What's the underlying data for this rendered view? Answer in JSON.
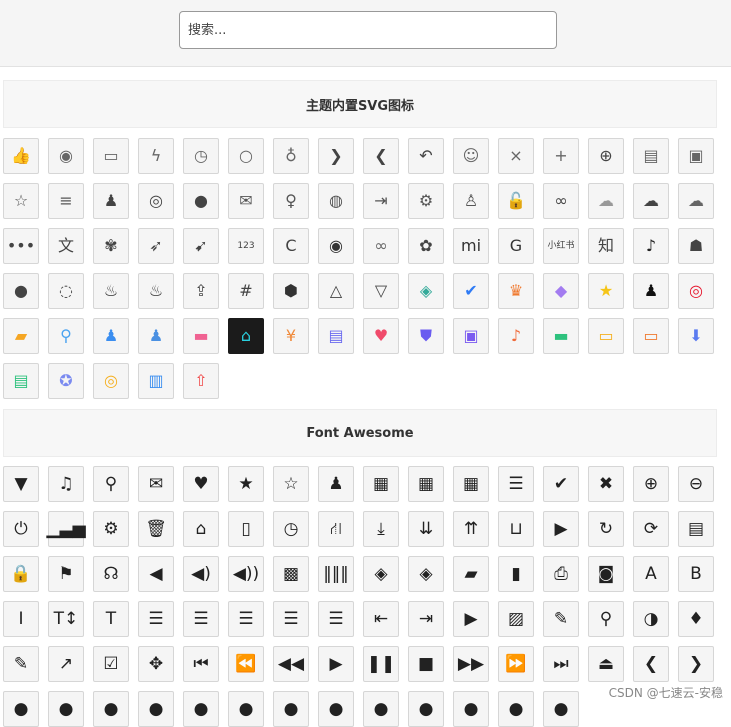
{
  "search": {
    "placeholder": "搜索..."
  },
  "sections": {
    "svg": {
      "title": "主题内置SVG图标"
    },
    "fa": {
      "title": "Font Awesome"
    }
  },
  "watermark": "CSDN @七速云-安稳",
  "svg_icons": [
    {
      "name": "thumbs-up-icon",
      "glyph": "👍",
      "color": "#666"
    },
    {
      "name": "eye-icon",
      "glyph": "◉",
      "color": "#666"
    },
    {
      "name": "comment-icon",
      "glyph": "▭",
      "color": "#666"
    },
    {
      "name": "lightning-circle-icon",
      "glyph": "ϟ",
      "color": "#666"
    },
    {
      "name": "clock-icon",
      "glyph": "◷",
      "color": "#666"
    },
    {
      "name": "search-icon",
      "glyph": "○",
      "color": "#666"
    },
    {
      "name": "money-bag-icon",
      "glyph": "♁",
      "color": "#666"
    },
    {
      "name": "chevron-right-icon",
      "glyph": "❯",
      "color": "#444"
    },
    {
      "name": "chevron-left-icon",
      "glyph": "❮",
      "color": "#444"
    },
    {
      "name": "reply-icon",
      "glyph": "↶",
      "color": "#444"
    },
    {
      "name": "github-icon",
      "glyph": "☺",
      "color": "#666"
    },
    {
      "name": "close-icon",
      "glyph": "×",
      "color": "#666"
    },
    {
      "name": "plus-icon",
      "glyph": "+",
      "color": "#666"
    },
    {
      "name": "plus-circle-icon",
      "glyph": "⊕",
      "color": "#444"
    },
    {
      "name": "document-icon",
      "glyph": "▤",
      "color": "#666"
    },
    {
      "name": "chat-icon",
      "glyph": "▣",
      "color": "#666"
    },
    {
      "name": "star-outline-icon",
      "glyph": "☆",
      "color": "#555"
    },
    {
      "name": "menu-icon",
      "glyph": "≡",
      "color": "#555"
    },
    {
      "name": "qq-icon",
      "glyph": "♟",
      "color": "#444"
    },
    {
      "name": "weibo-icon",
      "glyph": "◎",
      "color": "#444"
    },
    {
      "name": "wechat-icon",
      "glyph": "●",
      "color": "#444"
    },
    {
      "name": "mail-icon",
      "glyph": "✉",
      "color": "#555"
    },
    {
      "name": "badge-icon",
      "glyph": "♀",
      "color": "#555"
    },
    {
      "name": "palette-icon",
      "glyph": "◍",
      "color": "#555"
    },
    {
      "name": "login-icon",
      "glyph": "⇥",
      "color": "#555"
    },
    {
      "name": "settings-icon",
      "glyph": "⚙",
      "color": "#555"
    },
    {
      "name": "add-user-icon",
      "glyph": "♙",
      "color": "#555"
    },
    {
      "name": "unlock-icon",
      "glyph": "🔓",
      "color": "#555"
    },
    {
      "name": "circles-icon",
      "glyph": "∞",
      "color": "#444"
    },
    {
      "name": "cloud-icon",
      "glyph": "☁",
      "color": "#999"
    },
    {
      "name": "cloud-filled-icon",
      "glyph": "☁",
      "color": "#444"
    },
    {
      "name": "cloud-link-icon",
      "glyph": "☁",
      "color": "#666"
    },
    {
      "name": "more-icon",
      "glyph": "•••",
      "color": "#444"
    },
    {
      "name": "translate-icon",
      "glyph": "文",
      "color": "#444"
    },
    {
      "name": "baidu-icon",
      "glyph": "✾",
      "color": "#444"
    },
    {
      "name": "bird-icon",
      "glyph": "➶",
      "color": "#444"
    },
    {
      "name": "dove-icon",
      "glyph": "➹",
      "color": "#444"
    },
    {
      "name": "counter-icon",
      "glyph": "123",
      "color": "#444",
      "small": true
    },
    {
      "name": "c-logo-icon",
      "glyph": "C",
      "color": "#444"
    },
    {
      "name": "ring-icon",
      "glyph": "◉",
      "color": "#333"
    },
    {
      "name": "link-icon",
      "glyph": "∞",
      "color": "#666"
    },
    {
      "name": "huawei-icon",
      "glyph": "✿",
      "color": "#444"
    },
    {
      "name": "xiaomi-icon",
      "glyph": "mi",
      "color": "#333"
    },
    {
      "name": "g-logo-icon",
      "glyph": "G",
      "color": "#333"
    },
    {
      "name": "brand-text-icon",
      "glyph": "小红书",
      "color": "#444",
      "small": true
    },
    {
      "name": "zhihu-icon",
      "glyph": "知",
      "color": "#444"
    },
    {
      "name": "tiktok-icon",
      "glyph": "♪",
      "color": "#222"
    },
    {
      "name": "bilibili-icon",
      "glyph": "☗",
      "color": "#444"
    },
    {
      "name": "speech-bubble-icon",
      "glyph": "●",
      "color": "#444"
    },
    {
      "name": "chat-dots-icon",
      "glyph": "◌",
      "color": "#444"
    },
    {
      "name": "flame-icon",
      "glyph": "♨",
      "color": "#333"
    },
    {
      "name": "fire-icon",
      "glyph": "♨",
      "color": "#333"
    },
    {
      "name": "upload-icon",
      "glyph": "⇪",
      "color": "#444"
    },
    {
      "name": "hash-icon",
      "glyph": "#",
      "color": "#444"
    },
    {
      "name": "cube-icon",
      "glyph": "⬢",
      "color": "#333"
    },
    {
      "name": "triangle-up-icon",
      "glyph": "△",
      "color": "#444"
    },
    {
      "name": "triangle-down-icon",
      "glyph": "▽",
      "color": "#444"
    },
    {
      "name": "tag-icon",
      "glyph": "◈",
      "color": "#3a9"
    },
    {
      "name": "verified-icon",
      "glyph": "✔",
      "color": "#2f7bf5"
    },
    {
      "name": "crown-icon",
      "glyph": "♛",
      "color": "#f07a30"
    },
    {
      "name": "diamond-icon",
      "glyph": "◆",
      "color": "#a37cf0"
    },
    {
      "name": "star-badge-icon",
      "glyph": "★",
      "color": "#f5c518"
    },
    {
      "name": "qq-color-icon",
      "glyph": "♟",
      "color": "#111"
    },
    {
      "name": "weibo-color-icon",
      "glyph": "◎",
      "color": "#e6162d"
    },
    {
      "name": "image-color-icon",
      "glyph": "▰",
      "color": "#f5a623"
    },
    {
      "name": "link-color-icon",
      "glyph": "⚲",
      "color": "#4aa3f0"
    },
    {
      "name": "user-card-icon",
      "glyph": "♟",
      "color": "#3b8ef0"
    },
    {
      "name": "user-color-icon",
      "glyph": "♟",
      "color": "#4a90e2"
    },
    {
      "name": "battery-icon",
      "glyph": "▬",
      "color": "#f06292"
    },
    {
      "name": "home-icon",
      "glyph": "⌂",
      "color": "#2ad1e0",
      "dark": true
    },
    {
      "name": "money-color-icon",
      "glyph": "¥",
      "color": "#f08a3a"
    },
    {
      "name": "clipboard-icon",
      "glyph": "▤",
      "color": "#6c6cf0"
    },
    {
      "name": "gift-icon",
      "glyph": "♥",
      "color": "#f04b6b"
    },
    {
      "name": "shield-icon",
      "glyph": "⛊",
      "color": "#6a5cf0"
    },
    {
      "name": "monitor-chart-icon",
      "glyph": "▣",
      "color": "#7a5af0"
    },
    {
      "name": "bell-icon",
      "glyph": "♪",
      "color": "#f06a3a"
    },
    {
      "name": "wallet-icon",
      "glyph": "▬",
      "color": "#2ec27e"
    },
    {
      "name": "message-color-icon",
      "glyph": "▭",
      "color": "#f5b020"
    },
    {
      "name": "card-color-icon",
      "glyph": "▭",
      "color": "#f07a30"
    },
    {
      "name": "download-box-icon",
      "glyph": "⬇",
      "color": "#5b7bf0"
    },
    {
      "name": "store-icon",
      "glyph": "▤",
      "color": "#2ec27e"
    },
    {
      "name": "medal-icon",
      "glyph": "✪",
      "color": "#7a8af0"
    },
    {
      "name": "coins-icon",
      "glyph": "◎",
      "color": "#f5b020"
    },
    {
      "name": "book-icon",
      "glyph": "▥",
      "color": "#3b8ef0"
    },
    {
      "name": "rocket-icon",
      "glyph": "⇧",
      "color": "#f04b4b"
    }
  ],
  "fa_icons": [
    {
      "name": "filter-icon",
      "glyph": "▼",
      "color": "#222"
    },
    {
      "name": "music-icon",
      "glyph": "♫",
      "color": "#222"
    },
    {
      "name": "search-icon",
      "glyph": "⚲",
      "color": "#222"
    },
    {
      "name": "envelope-icon",
      "glyph": "✉",
      "color": "#222"
    },
    {
      "name": "heart-icon",
      "glyph": "♥",
      "color": "#222"
    },
    {
      "name": "star-icon",
      "glyph": "★",
      "color": "#222"
    },
    {
      "name": "star-empty-icon",
      "glyph": "☆",
      "color": "#222"
    },
    {
      "name": "user-icon",
      "glyph": "♟",
      "color": "#222"
    },
    {
      "name": "film-icon",
      "glyph": "▦",
      "color": "#222"
    },
    {
      "name": "th-large-icon",
      "glyph": "▦",
      "color": "#222"
    },
    {
      "name": "th-icon",
      "glyph": "▦",
      "color": "#222"
    },
    {
      "name": "th-list-icon",
      "glyph": "☰",
      "color": "#222"
    },
    {
      "name": "check-icon",
      "glyph": "✔",
      "color": "#222"
    },
    {
      "name": "times-icon",
      "glyph": "✖",
      "color": "#222"
    },
    {
      "name": "zoom-in-icon",
      "glyph": "⊕",
      "color": "#222"
    },
    {
      "name": "zoom-out-icon",
      "glyph": "⊖",
      "color": "#222"
    },
    {
      "name": "power-off-icon",
      "glyph": "⏻",
      "color": "#222"
    },
    {
      "name": "signal-icon",
      "glyph": "▁▃▅",
      "color": "#222",
      "small": true
    },
    {
      "name": "cog-icon",
      "glyph": "⚙",
      "color": "#222"
    },
    {
      "name": "trash-icon",
      "glyph": "🗑",
      "color": "#222"
    },
    {
      "name": "home-icon",
      "glyph": "⌂",
      "color": "#222"
    },
    {
      "name": "file-icon",
      "glyph": "▯",
      "color": "#222"
    },
    {
      "name": "clock-icon",
      "glyph": "◷",
      "color": "#222"
    },
    {
      "name": "road-icon",
      "glyph": "⛙",
      "color": "#222"
    },
    {
      "name": "download-icon",
      "glyph": "⤓",
      "color": "#222"
    },
    {
      "name": "arrow-circle-down-icon",
      "glyph": "⇊",
      "color": "#222"
    },
    {
      "name": "arrow-circle-up-icon",
      "glyph": "⇈",
      "color": "#222"
    },
    {
      "name": "inbox-icon",
      "glyph": "⊔",
      "color": "#222"
    },
    {
      "name": "play-circle-icon",
      "glyph": "▶",
      "color": "#222"
    },
    {
      "name": "repeat-icon",
      "glyph": "↻",
      "color": "#222"
    },
    {
      "name": "refresh-icon",
      "glyph": "⟳",
      "color": "#222"
    },
    {
      "name": "list-alt-icon",
      "glyph": "▤",
      "color": "#222"
    },
    {
      "name": "lock-icon",
      "glyph": "🔒",
      "color": "#222"
    },
    {
      "name": "flag-icon",
      "glyph": "⚑",
      "color": "#222"
    },
    {
      "name": "headphones-icon",
      "glyph": "☊",
      "color": "#222"
    },
    {
      "name": "volume-off-icon",
      "glyph": "◀",
      "color": "#222"
    },
    {
      "name": "volume-down-icon",
      "glyph": "◀)",
      "color": "#222",
      "small": true
    },
    {
      "name": "volume-up-icon",
      "glyph": "◀))",
      "color": "#222",
      "small": true
    },
    {
      "name": "qrcode-icon",
      "glyph": "▩",
      "color": "#222"
    },
    {
      "name": "barcode-icon",
      "glyph": "‖‖‖",
      "color": "#222",
      "small": true
    },
    {
      "name": "tag-icon",
      "glyph": "◈",
      "color": "#222"
    },
    {
      "name": "tags-icon",
      "glyph": "◈",
      "color": "#222"
    },
    {
      "name": "book-icon",
      "glyph": "▰",
      "color": "#222"
    },
    {
      "name": "bookmark-icon",
      "glyph": "▮",
      "color": "#222"
    },
    {
      "name": "print-icon",
      "glyph": "⎙",
      "color": "#222"
    },
    {
      "name": "camera-icon",
      "glyph": "◙",
      "color": "#222"
    },
    {
      "name": "font-icon",
      "glyph": "A",
      "color": "#222"
    },
    {
      "name": "bold-icon",
      "glyph": "B",
      "color": "#222"
    },
    {
      "name": "italic-icon",
      "glyph": "I",
      "color": "#222"
    },
    {
      "name": "text-height-icon",
      "glyph": "T↕",
      "color": "#222"
    },
    {
      "name": "text-width-icon",
      "glyph": "T",
      "color": "#222"
    },
    {
      "name": "align-left-icon",
      "glyph": "☰",
      "color": "#222"
    },
    {
      "name": "align-center-icon",
      "glyph": "☰",
      "color": "#222"
    },
    {
      "name": "align-right-icon",
      "glyph": "☰",
      "color": "#222"
    },
    {
      "name": "align-justify-icon",
      "glyph": "☰",
      "color": "#222"
    },
    {
      "name": "list-icon",
      "glyph": "☰",
      "color": "#222"
    },
    {
      "name": "outdent-icon",
      "glyph": "⇤",
      "color": "#222"
    },
    {
      "name": "indent-icon",
      "glyph": "⇥",
      "color": "#222"
    },
    {
      "name": "video-camera-icon",
      "glyph": "▶",
      "color": "#222"
    },
    {
      "name": "picture-icon",
      "glyph": "▨",
      "color": "#222"
    },
    {
      "name": "pencil-icon",
      "glyph": "✎",
      "color": "#222"
    },
    {
      "name": "map-marker-icon",
      "glyph": "⚲",
      "color": "#222"
    },
    {
      "name": "adjust-icon",
      "glyph": "◑",
      "color": "#222"
    },
    {
      "name": "tint-icon",
      "glyph": "♦",
      "color": "#222"
    },
    {
      "name": "edit-icon",
      "glyph": "✎",
      "color": "#222"
    },
    {
      "name": "share-icon",
      "glyph": "↗",
      "color": "#222"
    },
    {
      "name": "check-square-icon",
      "glyph": "☑",
      "color": "#222"
    },
    {
      "name": "move-icon",
      "glyph": "✥",
      "color": "#222"
    },
    {
      "name": "step-backward-icon",
      "glyph": "⏮",
      "color": "#222"
    },
    {
      "name": "fast-backward-icon",
      "glyph": "⏪",
      "color": "#222"
    },
    {
      "name": "backward-icon",
      "glyph": "◀◀",
      "color": "#222",
      "small": true
    },
    {
      "name": "play-icon",
      "glyph": "▶",
      "color": "#222"
    },
    {
      "name": "pause-icon",
      "glyph": "❚❚",
      "color": "#222",
      "small": true
    },
    {
      "name": "stop-icon",
      "glyph": "■",
      "color": "#222"
    },
    {
      "name": "forward-icon",
      "glyph": "▶▶",
      "color": "#222",
      "small": true
    },
    {
      "name": "fast-forward-icon",
      "glyph": "⏩",
      "color": "#222"
    },
    {
      "name": "step-forward-icon",
      "glyph": "⏭",
      "color": "#222"
    },
    {
      "name": "eject-icon",
      "glyph": "⏏",
      "color": "#222"
    },
    {
      "name": "chevron-left-icon",
      "glyph": "❮",
      "color": "#222"
    },
    {
      "name": "chevron-right-icon",
      "glyph": "❯",
      "color": "#222"
    },
    {
      "name": "partial-icon-1",
      "glyph": "●",
      "color": "#222"
    },
    {
      "name": "partial-icon-2",
      "glyph": "●",
      "color": "#222"
    },
    {
      "name": "partial-icon-3",
      "glyph": "●",
      "color": "#222"
    },
    {
      "name": "partial-icon-4",
      "glyph": "●",
      "color": "#222"
    },
    {
      "name": "partial-icon-5",
      "glyph": "●",
      "color": "#222"
    },
    {
      "name": "partial-icon-6",
      "glyph": "●",
      "color": "#222"
    },
    {
      "name": "partial-icon-7",
      "glyph": "●",
      "color": "#222"
    },
    {
      "name": "partial-icon-8",
      "glyph": "●",
      "color": "#222"
    },
    {
      "name": "partial-icon-9",
      "glyph": "●",
      "color": "#222"
    },
    {
      "name": "partial-icon-10",
      "glyph": "●",
      "color": "#222"
    },
    {
      "name": "partial-icon-11",
      "glyph": "●",
      "color": "#222"
    },
    {
      "name": "partial-icon-12",
      "glyph": "●",
      "color": "#222"
    },
    {
      "name": "partial-icon-13",
      "glyph": "●",
      "color": "#222"
    }
  ]
}
